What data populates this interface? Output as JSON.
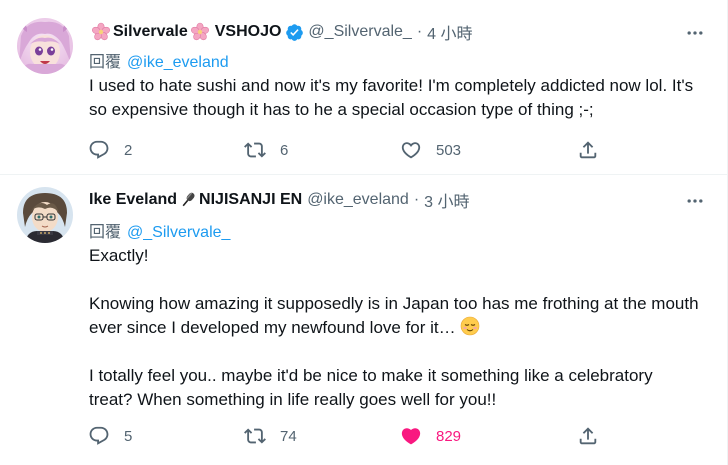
{
  "tweets": [
    {
      "name": "Silvervale",
      "name_suffix": "VSHOJO",
      "handle": "@_Silvervale_",
      "dot": "·",
      "time": "4 小時",
      "reply_prefix": "回覆",
      "reply_to": "@ike_eveland",
      "text": "I used to hate sushi and now it's my favorite! I'm completely addicted now lol. It's so expensive though it has to he a special occasion type of thing ;-;",
      "replies": "2",
      "retweets": "6",
      "likes": "503",
      "liked": false,
      "icons": {
        "name_decor": "cherry-blossom-icon",
        "badge": "verified-badge-icon"
      }
    },
    {
      "name": "Ike Eveland",
      "name_suffix": "NIJISANJI EN",
      "handle": "@ike_eveland",
      "dot": "·",
      "time": "3 小時",
      "reply_prefix": "回覆",
      "reply_to": "@_Silvervale_",
      "text_p1": "Exactly!",
      "text_p2": "Knowing how amazing it supposedly is in Japan too has me frothing at the mouth ever since I developed my newfound love for it…",
      "text_p3": "I totally feel you.. maybe it'd be nice to make it something like a celebratory treat? When something in life really goes well for you!!",
      "replies": "5",
      "retweets": "74",
      "likes": "829",
      "liked": true,
      "icons": {
        "name_decor": "microphone-icon",
        "emoji": "relieved-face-emoji"
      }
    }
  ],
  "colors": {
    "text": "#0f1419",
    "secondary": "#536471",
    "link": "#1d9bf0",
    "like": "#f91880",
    "verified": "#1d9bf0"
  }
}
